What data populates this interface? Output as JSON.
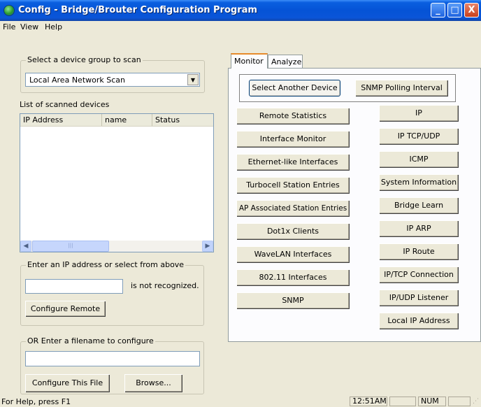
{
  "window": {
    "title": "Config - Bridge/Brouter Configuration Program",
    "controls": [
      "_",
      "□",
      "X"
    ]
  },
  "menu": {
    "file": "File",
    "view": "View",
    "help": "Help"
  },
  "scan_group": {
    "legend": "Select a device group to scan",
    "selected": "Local Area Network Scan"
  },
  "devices": {
    "label": "List of scanned devices",
    "columns": [
      "IP Address",
      "name",
      "Status"
    ],
    "rows": []
  },
  "ip_group": {
    "legend": "Enter an IP address or select from above",
    "ip_value": "",
    "status_text": "is not recognized.",
    "configure_remote": "Configure Remote"
  },
  "file_group": {
    "legend": "OR Enter a filename to configure",
    "filename_value": "",
    "configure_file": "Configure This File",
    "browse": "Browse..."
  },
  "tabs": {
    "monitor": "Monitor",
    "analyze": "Analyze"
  },
  "monitor": {
    "select_device": "Select Another Device",
    "snmp_interval": "SNMP Polling Interval",
    "left_buttons": [
      "Remote Statistics",
      "Interface Monitor",
      "Ethernet-like Interfaces",
      "Turbocell Station Entries",
      "AP Associated Station Entries",
      "Dot1x Clients",
      "WaveLAN Interfaces",
      "802.11 Interfaces",
      "SNMP"
    ],
    "right_buttons": [
      "IP",
      "IP TCP/UDP",
      "ICMP",
      "System Information",
      "Bridge Learn",
      "IP ARP",
      "IP Route",
      "IP/TCP Connection",
      "IP/UDP Listener",
      "Local IP Address"
    ]
  },
  "status": {
    "help": "For Help, press F1",
    "time": "12:51AM",
    "num": "NUM"
  }
}
